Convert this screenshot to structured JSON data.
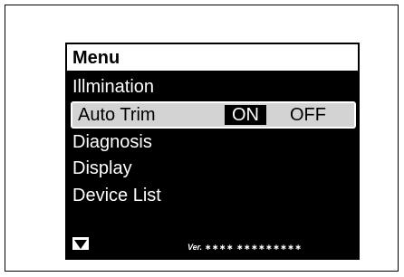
{
  "menu": {
    "title": "Menu",
    "items": [
      {
        "label": "Illmination"
      },
      {
        "label": "Auto Trim",
        "options": [
          "ON",
          "OFF"
        ],
        "selected_option": "ON"
      },
      {
        "label": "Diagnosis"
      },
      {
        "label": "Display"
      },
      {
        "label": "Device List"
      }
    ],
    "scroll_icon": "down-triangle-icon",
    "version_prefix": "Ver.",
    "version_value": "∗∗∗∗ ∗∗∗∗∗∗∗∗∗"
  },
  "colors": {
    "screen_bg": "#000000",
    "highlight_bg": "#d3d3d3",
    "text_light": "#ffffff"
  }
}
